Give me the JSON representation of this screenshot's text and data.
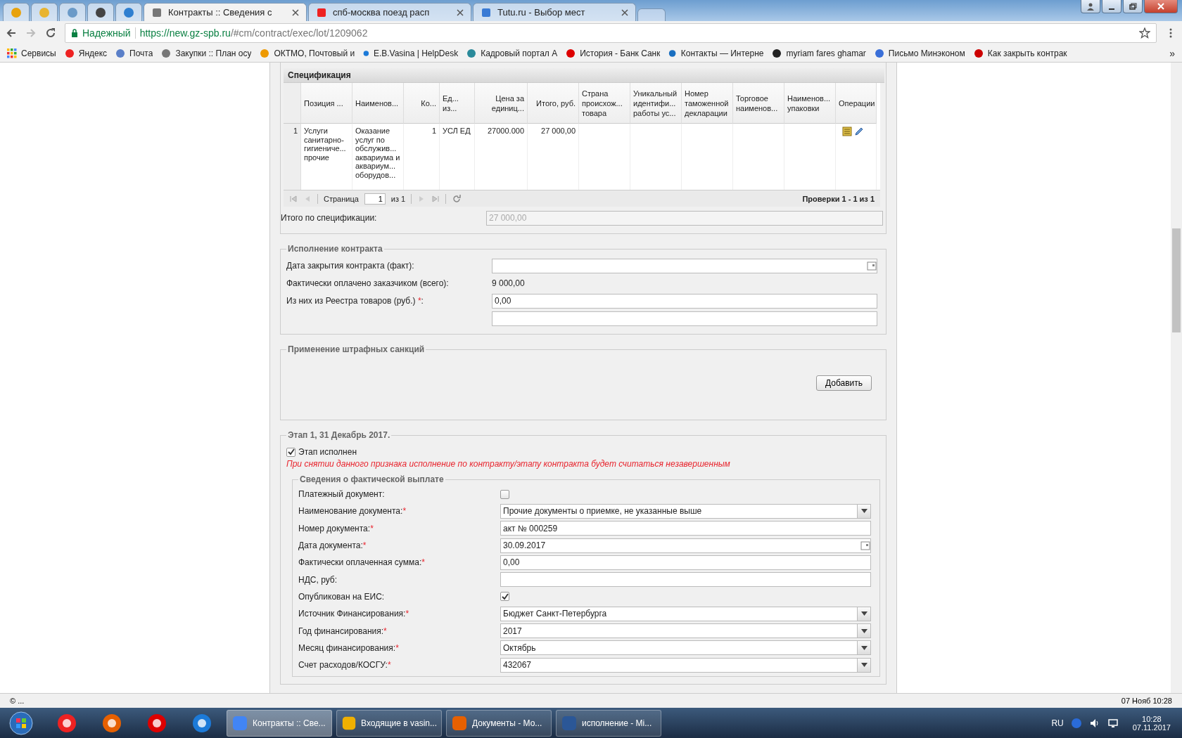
{
  "browser": {
    "tabs": [
      {
        "kind": "icon",
        "selected": false
      },
      {
        "kind": "icon",
        "selected": false
      },
      {
        "kind": "icon",
        "selected": false
      },
      {
        "kind": "icon",
        "selected": false
      },
      {
        "kind": "icon",
        "selected": false
      },
      {
        "kind": "text",
        "label": "Контракты :: Сведения с",
        "selected": true
      },
      {
        "kind": "text",
        "label": "спб-москва поезд расп",
        "selected": false
      },
      {
        "kind": "text",
        "label": "Tutu.ru - Выбор мест",
        "selected": false
      }
    ],
    "secure_label": "Надежный",
    "url_host": "https://new.gz-spb.ru",
    "url_path": "/#cm/contract/exec/lot/1209062",
    "bookmarks": [
      "Сервисы",
      "Яндекс",
      "Почта",
      "Закупки :: План осу",
      "ОКТМО, Почтовый и",
      "E.B.Vasina | HelpDesk",
      "Кадровый портал А",
      "История - Банк Санк",
      "Контакты — Интерне",
      "myriam fares ghamar",
      "Письмо Минэконом",
      "Как закрыть контрак"
    ],
    "bookmarks_more": "»"
  },
  "specification": {
    "title": "Спецификация",
    "columns": [
      "Позиция ...",
      "Наименов...",
      "Ко...",
      "Ед... из...",
      "Цена за единиц...",
      "Итого, руб.",
      "Страна происхож... товара",
      "Уникальный идентифи... работы ус...",
      "Номер таможенной декларации",
      "Торговое наименов...",
      "Наименов... упаковки",
      "Операции"
    ],
    "rows": [
      {
        "number": "1",
        "cells": [
          "Услуги санитарно-гигиениче... прочие",
          "Оказание услуг по обслужив... аквариума и аквариум... оборудов...",
          "1",
          "УСЛ ЕД",
          "27000.000",
          "27 000,00"
        ]
      }
    ],
    "pager": {
      "page_label": "Страница",
      "page_value": "1",
      "page_of": "из 1",
      "summary": "Проверки 1 - 1 из 1"
    },
    "total_label": "Итого по спецификации:",
    "total_value": "27 000,00"
  },
  "execution": {
    "title": "Исполнение контракта",
    "fields": [
      {
        "kind": "date",
        "label": "Дата закрытия контракта (факт):"
      },
      {
        "kind": "text",
        "label": "Фактически оплачено заказчиком (всего):",
        "value": "9 000,00"
      },
      {
        "kind": "input",
        "label": "Из них из Реестра товаров (руб.) ",
        "mark": "*",
        "suffix": ":",
        "value": "0,00"
      },
      {
        "kind": "input"
      }
    ]
  },
  "penalties": {
    "title": "Применение штрафных санкций",
    "button": "Добавить"
  },
  "stage": {
    "title": "Этап 1, 31 Декабрь 2017.",
    "checkbox": {
      "label": "Этап исполнен",
      "checked": true
    },
    "warning": "При снятии данного признака исполнение по контракту/этапу контракта будет считаться незавершенным",
    "payment": {
      "title": "Сведения о фактической выплате",
      "fields": [
        {
          "kind": "checkbox",
          "label": "Платежный документ:",
          "checked": false
        },
        {
          "kind": "select",
          "label": "Наименование документа:",
          "mark": "*",
          "value": "Прочие документы о приемке, не указанные выше"
        },
        {
          "kind": "input",
          "label": "Номер документа:",
          "mark": "*",
          "value": "акт № 000259"
        },
        {
          "kind": "date",
          "label": "Дата документа:",
          "mark": "*",
          "value": "30.09.2017"
        },
        {
          "kind": "input",
          "label": "Фактически оплаченная сумма:",
          "mark": "*",
          "value": "0,00"
        },
        {
          "kind": "input",
          "label": "НДС, руб:"
        },
        {
          "kind": "checkbox",
          "label": "Опубликован на ЕИС:",
          "checked": true
        },
        {
          "kind": "select",
          "label": "Источник Финансирования:",
          "mark": "*",
          "value": "Бюджет Санкт-Петербурга"
        },
        {
          "kind": "select",
          "label": "Год финансирования:",
          "mark": "*",
          "value": "2017"
        },
        {
          "kind": "select",
          "label": "Месяц финансирования:",
          "mark": "*",
          "value": "Октябрь"
        },
        {
          "kind": "select",
          "label": "Счет расходов/КОСГУ:",
          "mark": "*",
          "value": "432067"
        }
      ]
    }
  },
  "status_bar": {
    "left": "© ...",
    "right": "07 Нояб 10:28"
  },
  "taskbar": {
    "items": [
      {
        "label": "Контракты :: Све...",
        "selected": true
      },
      {
        "label": "Входящие в vasin...",
        "selected": false
      },
      {
        "label": "Документы - Мо...",
        "selected": false
      },
      {
        "label": "исполнение - Mi...",
        "selected": false
      }
    ],
    "language": "RU",
    "time": "10:28",
    "date": "07.11.2017"
  }
}
